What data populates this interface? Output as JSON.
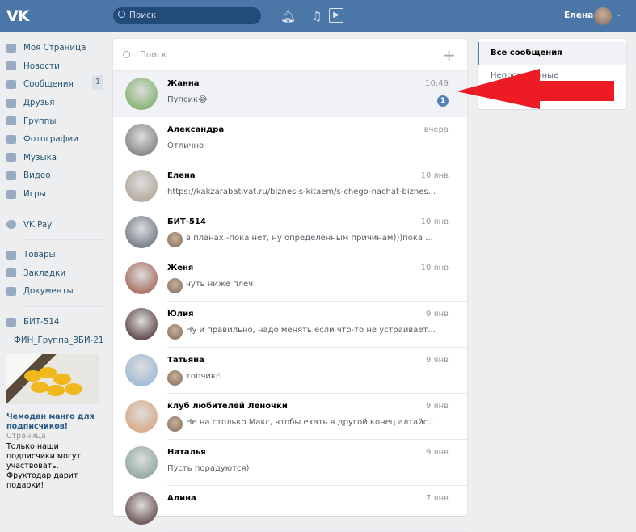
{
  "header": {
    "logo": "VK",
    "search_placeholder": "Поиск",
    "user_name": "Елена"
  },
  "sidebar": {
    "items": [
      {
        "label": "Моя Страница"
      },
      {
        "label": "Новости"
      },
      {
        "label": "Сообщения",
        "count": "1"
      },
      {
        "label": "Друзья"
      },
      {
        "label": "Группы"
      },
      {
        "label": "Фотографии"
      },
      {
        "label": "Музыка"
      },
      {
        "label": "Видео"
      },
      {
        "label": "Игры"
      }
    ],
    "pay": {
      "label": "VK Pay"
    },
    "items2": [
      {
        "label": "Товары"
      },
      {
        "label": "Закладки"
      },
      {
        "label": "Документы"
      }
    ],
    "groups": [
      {
        "label": "БИТ-514"
      },
      {
        "label": "ФИН_Группа_ЗБИ-21"
      }
    ],
    "ad": {
      "title": "Чемодан манго для подписчиков!",
      "subtitle": "Страница",
      "desc": "Только наши подписчики могут участвовать. Фруктодар дарит подарки!"
    }
  },
  "messages": {
    "search_placeholder": "Поиск",
    "rows": [
      {
        "name": "Жанна",
        "time": "10:49",
        "text": "Пупсик😂",
        "unread": "1",
        "color": "#6aa84f"
      },
      {
        "name": "Александра",
        "time": "вчера",
        "text": "Отлично",
        "color": "#6b6b6b"
      },
      {
        "name": "Елена",
        "time": "10 янв",
        "text": "https://kakzarabativat.ru/biznes-s-kitaem/s-chego-nachat-biznes...",
        "color": "#a89888"
      },
      {
        "name": "БИТ-514",
        "time": "10 янв",
        "text": "в планах -пока нет, ну определенным причинам)))пока ...",
        "color": "#556070"
      },
      {
        "name": "Женя",
        "time": "10 янв",
        "text": "чуть ниже плеч",
        "color": "#9a4a3a"
      },
      {
        "name": "Юлия",
        "time": "9 янв",
        "text": "Ну и правильно, надо менять если что-то не устраивает...",
        "color": "#3a1a1a"
      },
      {
        "name": "Татьяна",
        "time": "9 янв",
        "text": "топчик☝",
        "color": "#8fb0d8"
      },
      {
        "name": "клуб любителей Леночки",
        "time": "9 янв",
        "text": "Не на столько Макс, чтобы ехать в другой конец алтайс...",
        "color": "#d89a6a"
      },
      {
        "name": "Наталья",
        "time": "9 янв",
        "text": "Пусть порадуются)",
        "color": "#7a9a8a"
      },
      {
        "name": "Алина",
        "time": "7 янв",
        "text": "",
        "color": "#4a2a2a"
      }
    ]
  },
  "filters": {
    "all": "Все сообщения",
    "unread": "Непрочитанные"
  },
  "annotation": {
    "arrow_color": "#ed1c24"
  }
}
